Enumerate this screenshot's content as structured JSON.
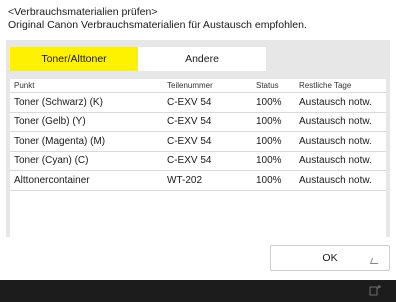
{
  "header": {
    "line1": "<Verbrauchsmaterialien prüfen>",
    "line2": "Original Canon Verbrauchsmaterialien für Austausch empfohlen."
  },
  "tabs": [
    {
      "label": "Toner/Alttoner",
      "active": true
    },
    {
      "label": "Andere",
      "active": false
    }
  ],
  "table": {
    "columns": [
      "Punkt",
      "Teilenummer",
      "Status",
      "Restliche Tage"
    ],
    "rows": [
      [
        "Toner (Schwarz) (K)",
        "C-EXV 54",
        "100%",
        "Austausch notw."
      ],
      [
        "Toner (Gelb) (Y)",
        "C-EXV 54",
        "100%",
        "Austausch notw."
      ],
      [
        "Toner (Magenta) (M)",
        "C-EXV 54",
        "100%",
        "Austausch notw."
      ],
      [
        "Toner (Cyan) (C)",
        "C-EXV 54",
        "100%",
        "Austausch notw."
      ],
      [
        "Alttonercontainer",
        "WT-202",
        "100%",
        "Austausch notw."
      ]
    ]
  },
  "ok_button": {
    "label": "OK"
  },
  "colors": {
    "active_tab": "#fff200",
    "panel_bg": "#e7e7e7",
    "bottom_bar": "#1c1c1c"
  },
  "icons": {
    "ok_corner": "enter-corner-icon",
    "status": "device-status-icon"
  }
}
